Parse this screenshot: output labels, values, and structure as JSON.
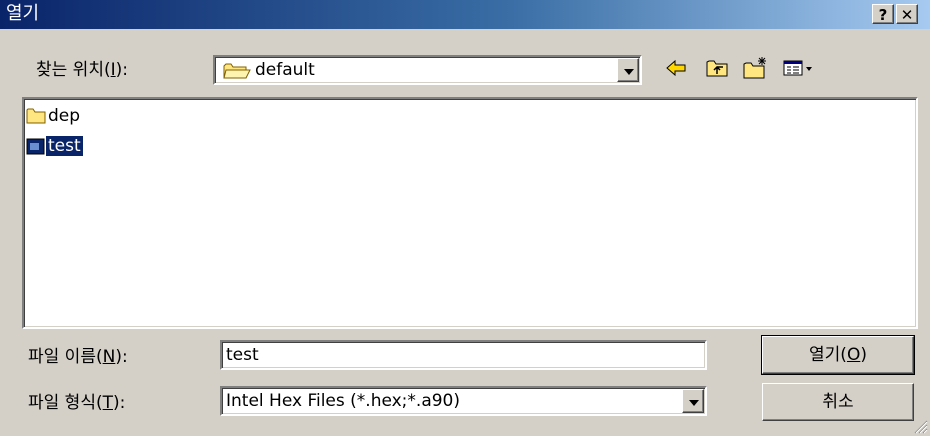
{
  "window": {
    "title": "열기",
    "help_label": "?",
    "close_label": "✕"
  },
  "lookin": {
    "label_prefix": "찾는 위치(",
    "label_key": "I",
    "label_suffix": "):",
    "value": "default"
  },
  "toolbar": {
    "back_icon": "back-arrow-icon",
    "up_icon": "up-folder-icon",
    "new_folder_icon": "new-folder-icon",
    "view_menu_icon": "view-menu-icon"
  },
  "files": {
    "items": [
      {
        "name": "dep",
        "icon": "folder-icon",
        "selected": false
      },
      {
        "name": "test",
        "icon": "file-icon",
        "selected": true
      }
    ]
  },
  "filename": {
    "label_prefix": "파일 이름(",
    "label_key": "N",
    "label_suffix": "):",
    "value": "test"
  },
  "filetype": {
    "label_prefix": "파일 형식(",
    "label_key": "T",
    "label_suffix": "):",
    "value": "Intel Hex Files (*.hex;*.a90)"
  },
  "buttons": {
    "open_prefix": "열기(",
    "open_key": "O",
    "open_suffix": ")",
    "cancel": "취소"
  },
  "colors": {
    "title_start": "#0a246a",
    "title_end": "#a6caf0",
    "selection": "#0a246a",
    "dialog_bg": "#d4d0c8"
  }
}
